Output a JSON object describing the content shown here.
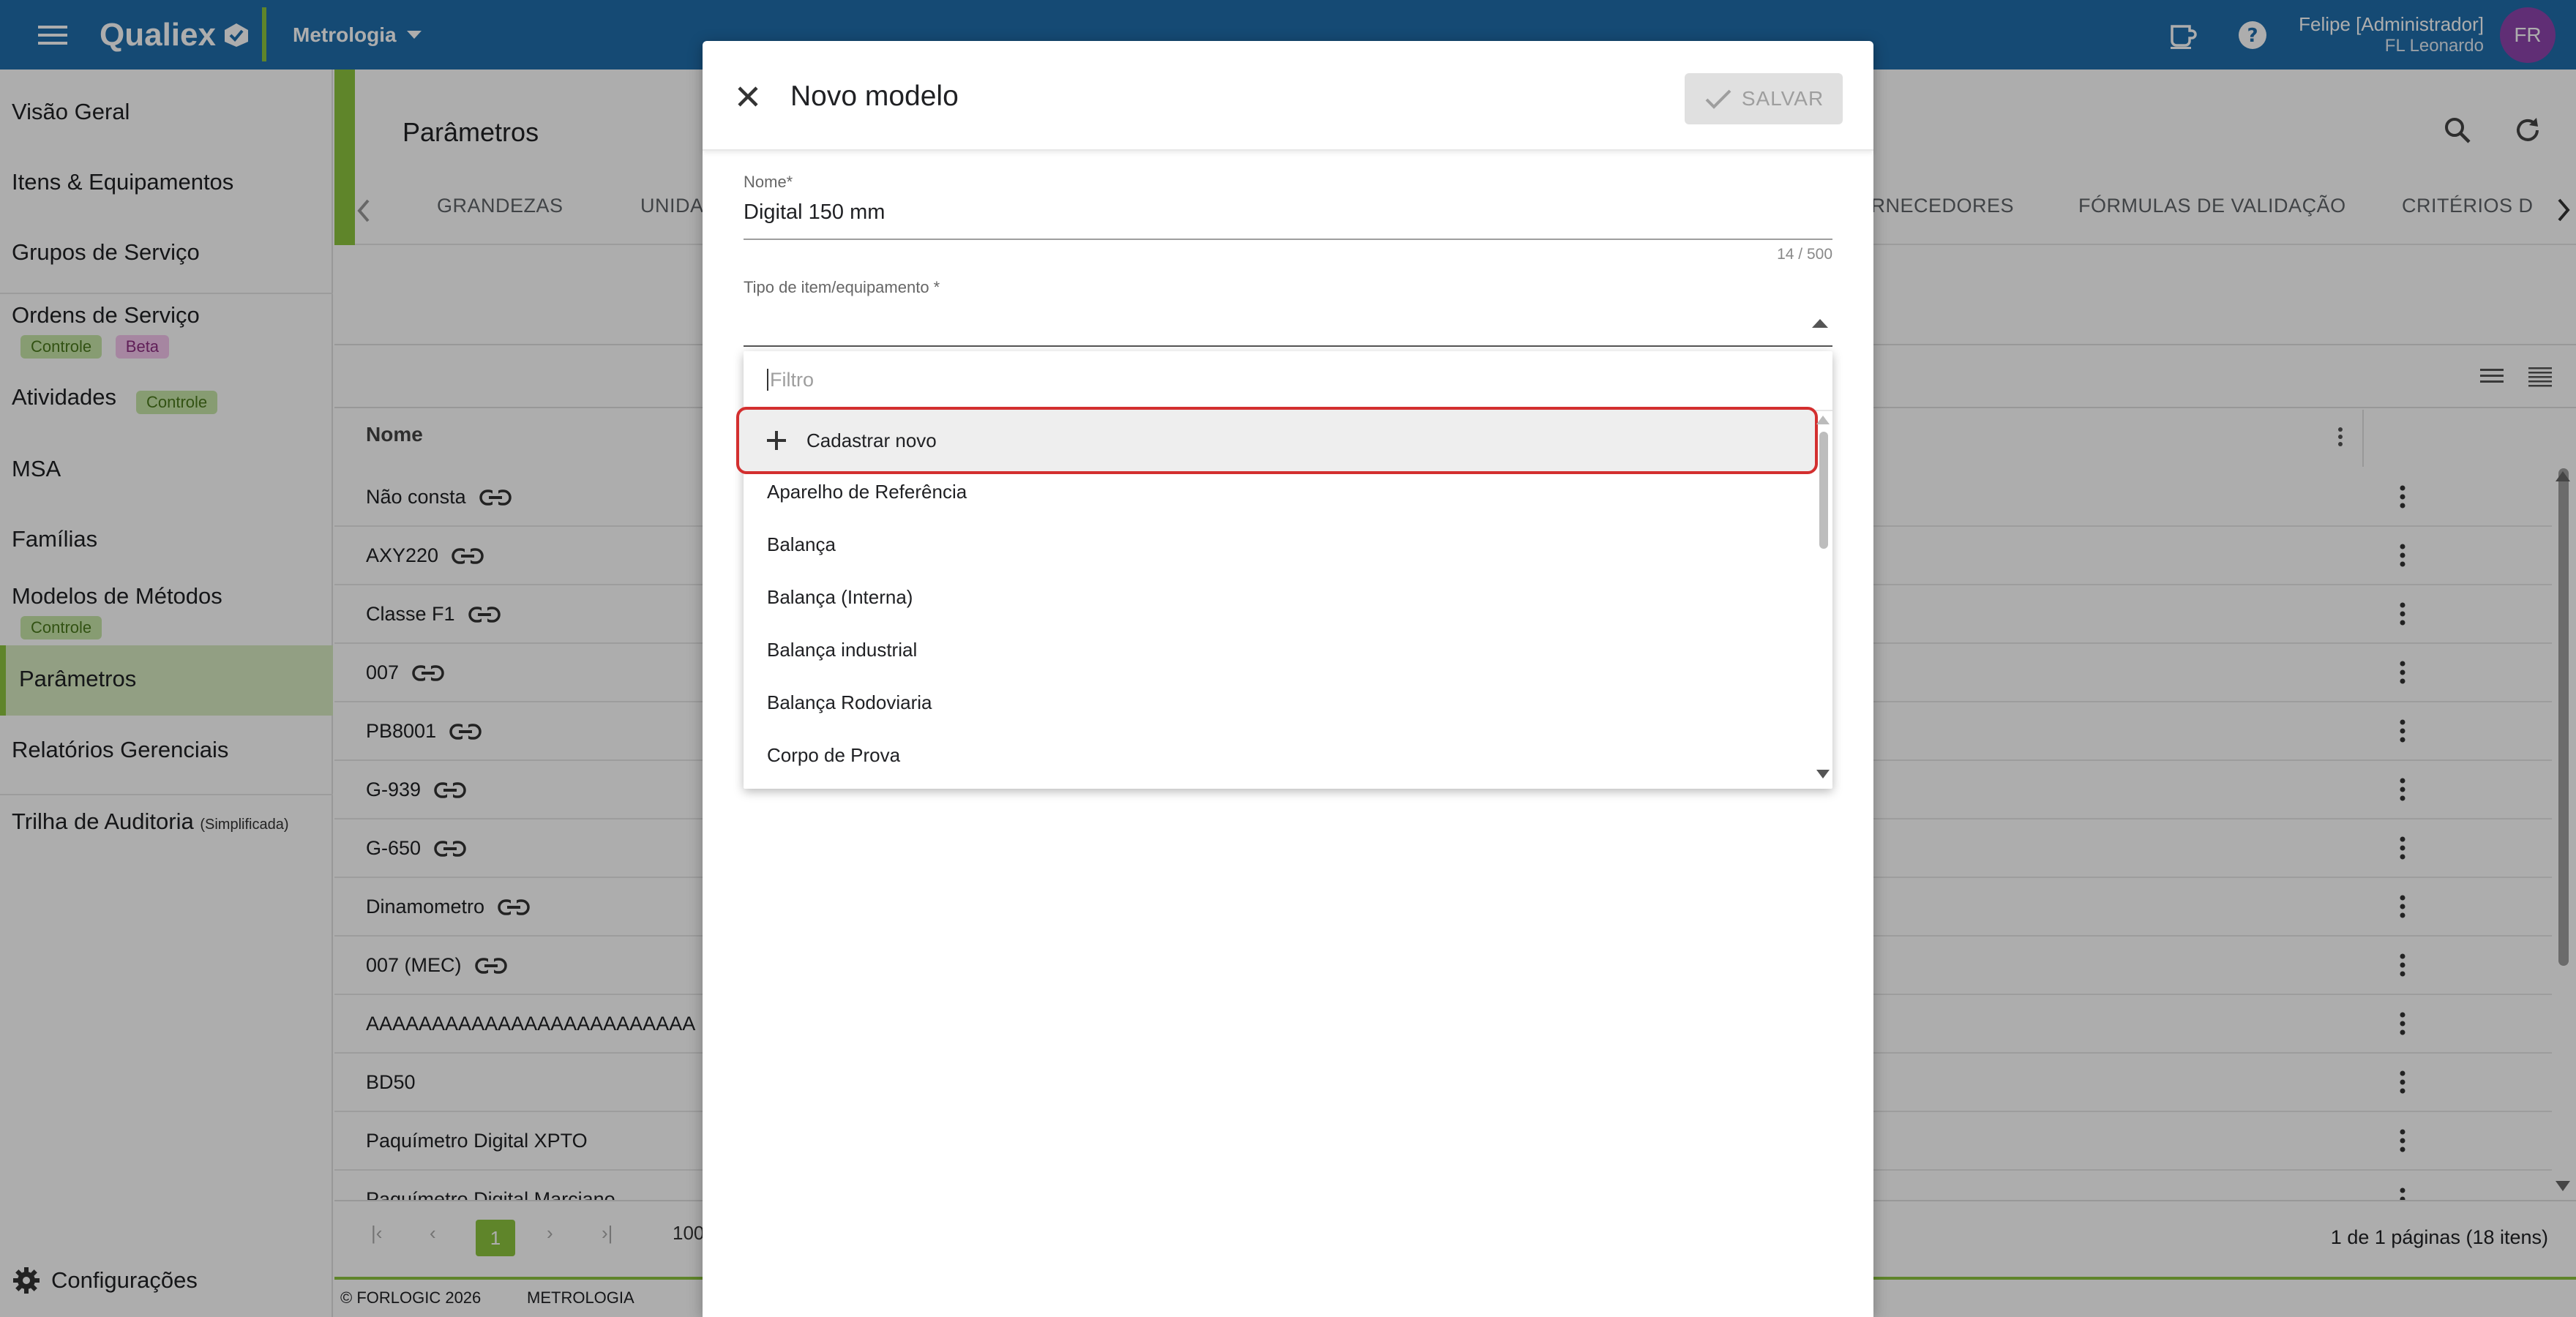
{
  "header": {
    "brand": "Qualiex",
    "module": "Metrologia",
    "user_name": "Felipe [Administrador]",
    "user_sub": "FL Leonardo",
    "avatar_initials": "FR"
  },
  "sidebar": {
    "items": [
      {
        "label": "Visão Geral"
      },
      {
        "label": "Itens & Equipamentos"
      },
      {
        "label": "Grupos de Serviço"
      },
      {
        "label": "Ordens de Serviço",
        "tags": [
          "Controle",
          "Beta"
        ]
      },
      {
        "label": "Atividades",
        "tags": [
          "Controle"
        ]
      },
      {
        "label": "MSA"
      },
      {
        "label": "Famílias"
      },
      {
        "label": "Modelos de Métodos",
        "tags": [
          "Controle"
        ]
      },
      {
        "label": "Parâmetros"
      },
      {
        "label": "Relatórios Gerenciais"
      },
      {
        "label": "Trilha de Auditoria",
        "suffix": "(Simplificada)"
      }
    ],
    "config_label": "Configurações"
  },
  "page": {
    "title": "Parâmetros",
    "tabs": [
      "GRANDEZAS",
      "UNIDA",
      "ORNECEDORES",
      "FÓRMULAS DE VALIDAÇÃO",
      "CRITÉRIOS D"
    ],
    "column_name": "Nome",
    "rows": [
      {
        "name": "Não consta",
        "linked": true
      },
      {
        "name": "AXY220",
        "linked": true
      },
      {
        "name": "Classe F1",
        "linked": true
      },
      {
        "name": "007",
        "linked": true
      },
      {
        "name": "PB8001",
        "linked": true
      },
      {
        "name": "G-939",
        "linked": true
      },
      {
        "name": "G-650",
        "linked": true
      },
      {
        "name": "Dinamometro",
        "linked": true
      },
      {
        "name": "007 (MEC)",
        "linked": true
      },
      {
        "name": "AAAAAAAAAAAAAAAAAAAAAAAAA",
        "linked": false
      },
      {
        "name": "BD50",
        "linked": false
      },
      {
        "name": "Paquímetro Digital XPTO",
        "linked": false
      },
      {
        "name": "Paquímetro Digital Marciano",
        "linked": false
      }
    ],
    "pager": {
      "current": "1",
      "page_size": "100",
      "info": "1 de 1 páginas (18 itens)"
    }
  },
  "footer": {
    "copyright": "© FORLOGIC 2026",
    "module": "METROLOGIA"
  },
  "modal": {
    "title": "Novo modelo",
    "save_label": "SALVAR",
    "name_label": "Nome*",
    "name_value": "Digital 150 mm",
    "name_counter": "14 / 500",
    "type_label": "Tipo de item/equipamento *",
    "dropdown": {
      "filter_placeholder": "Filtro",
      "new_label": "Cadastrar novo",
      "options": [
        "Aparelho de Referência",
        "Balança",
        "Balança (Interna)",
        "Balança industrial",
        "Balança Rodoviaria",
        "Corpo de Prova"
      ]
    }
  }
}
